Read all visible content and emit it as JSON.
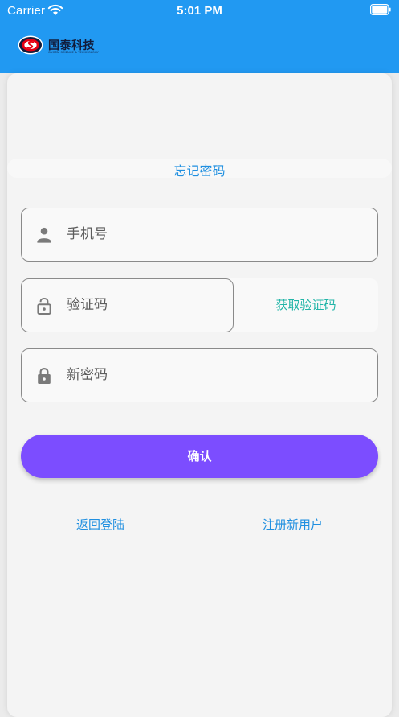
{
  "status_bar": {
    "carrier": "Carrier",
    "time": "5:01 PM"
  },
  "header": {
    "logo_name": "国泰科技",
    "logo_subtitle": "GUOTAI SCIENCE & TECHNOLOGY",
    "background_color": "#2199f2"
  },
  "page": {
    "title": "忘记密码"
  },
  "form": {
    "phone_placeholder": "手机号",
    "code_placeholder": "验证码",
    "get_code_label": "获取验证码",
    "new_password_placeholder": "新密码",
    "confirm_label": "确认"
  },
  "links": {
    "back_to_login": "返回登陆",
    "register": "注册新用户"
  },
  "colors": {
    "accent_blue": "#1f8fe0",
    "confirm_purple": "#7c4dff",
    "get_code_teal": "#22b5a8"
  },
  "icons": {
    "phone_field": "person-icon",
    "code_field": "lock-open-icon",
    "password_field": "lock-icon"
  }
}
